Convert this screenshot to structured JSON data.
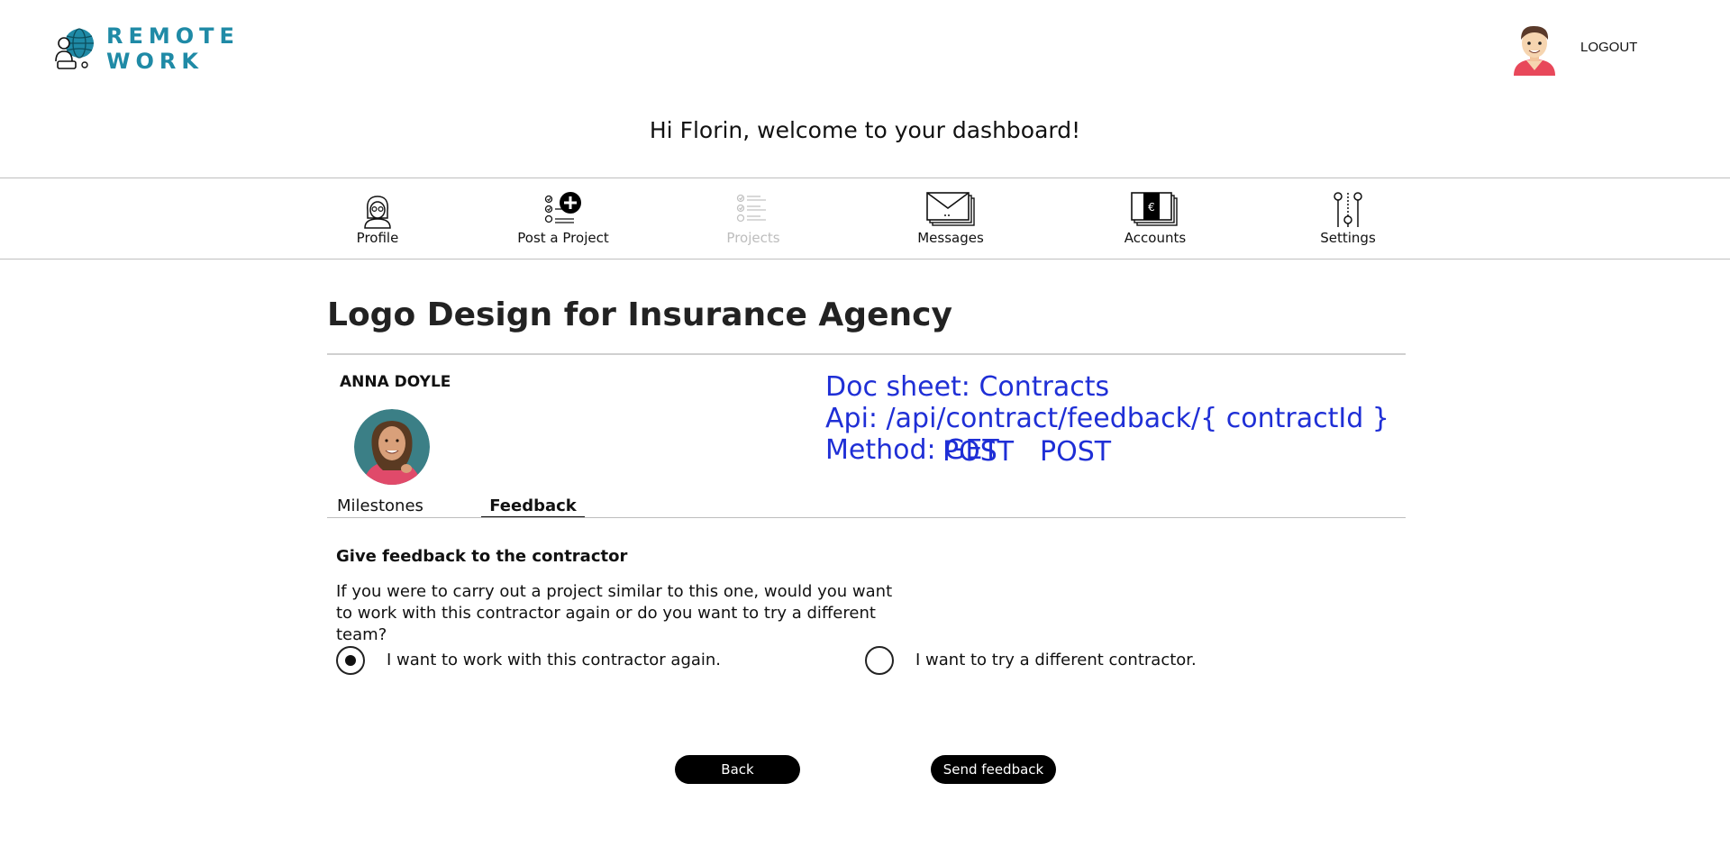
{
  "header": {
    "logo_line1": "REMOTE",
    "logo_line2": "WORK",
    "logout_label": "LOGOUT",
    "welcome": "Hi Florin, welcome to your dashboard!"
  },
  "nav": {
    "items": [
      {
        "label": "Profile",
        "icon": "profile-icon"
      },
      {
        "label": "Post a Project",
        "icon": "post-project-icon"
      },
      {
        "label": "Projects",
        "icon": "projects-list-icon",
        "disabled": true
      },
      {
        "label": "Messages",
        "icon": "envelope-icon"
      },
      {
        "label": "Accounts",
        "icon": "money-icon"
      },
      {
        "label": "Settings",
        "icon": "sliders-icon"
      }
    ]
  },
  "project": {
    "title": "Logo Design for Insurance Agency",
    "contractor_name": "ANNA DOYLE"
  },
  "doc_note": {
    "line1": "Doc sheet: Contracts",
    "line2": "Api: /api/contract/feedback/{ contractId }",
    "line3_prefix": "Method: GET",
    "overlap_text": "POST",
    "line3_suffix": "POST"
  },
  "tabs": {
    "milestones": "Milestones",
    "feedback": "Feedback",
    "active": "feedback"
  },
  "feedback": {
    "section_title": "Give feedback to the contractor",
    "question_line1": "If you were to carry out a project similar to this one, would you want",
    "question_line2": "to work with this contractor again or do you want to try a different team?",
    "option_again": "I want to work with this contractor again.",
    "option_different": "I want to try a different contractor.",
    "selected": "again"
  },
  "buttons": {
    "back": "Back",
    "send": "Send feedback"
  },
  "colors": {
    "brand": "#1f8aa6",
    "doc_note": "#1f2fd6",
    "disabled_nav": "#bdbdbd"
  }
}
